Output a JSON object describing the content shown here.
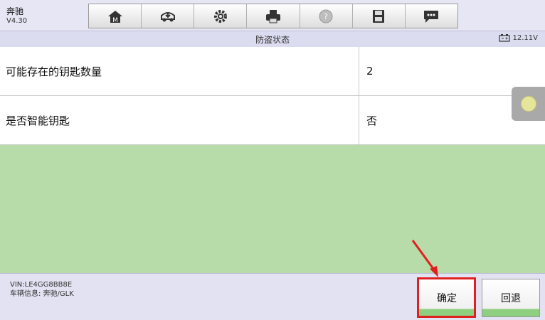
{
  "app": {
    "brand": "奔驰",
    "version": "V4.30"
  },
  "toolbar": {
    "buttons": [
      {
        "name": "home-icon"
      },
      {
        "name": "car-diagnose-icon"
      },
      {
        "name": "gear-icon"
      },
      {
        "name": "printer-icon"
      },
      {
        "name": "help-icon"
      },
      {
        "name": "save-icon"
      },
      {
        "name": "message-icon"
      }
    ]
  },
  "header": {
    "title": "防盗状态",
    "voltage": "12.11V"
  },
  "table": {
    "rows": [
      {
        "label": "可能存在的钥匙数量",
        "value": "2"
      },
      {
        "label": "是否智能钥匙",
        "value": "否"
      }
    ]
  },
  "footer": {
    "vin": "VIN:LE4GG8BB8E",
    "vehicle_info": "车辆信息: 奔驰/GLK",
    "ok_label": "确定",
    "back_label": "回退"
  },
  "colors": {
    "accent_green": "#b7dba9",
    "highlight": "#e02020"
  }
}
